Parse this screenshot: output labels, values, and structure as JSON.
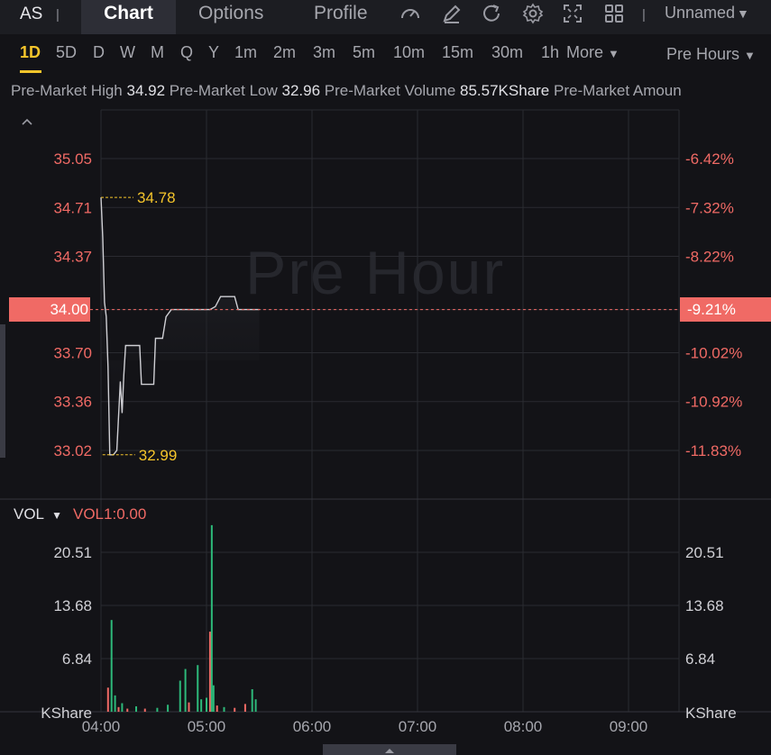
{
  "topnav": {
    "ticker": "AS",
    "sep": "|",
    "tabs": [
      {
        "label": "Chart",
        "active": true
      },
      {
        "label": "Options",
        "active": false
      },
      {
        "label": "Profile",
        "active": false
      }
    ],
    "icons": [
      "gauge-icon",
      "edit-icon",
      "refresh-icon",
      "gear-icon",
      "fullscreen-icon",
      "grid-icon"
    ],
    "account": "Unnamed"
  },
  "timeframes": [
    "1D",
    "5D",
    "D",
    "W",
    "M",
    "Q",
    "Y",
    "1m",
    "2m",
    "3m",
    "5m",
    "10m",
    "15m",
    "30m",
    "1h"
  ],
  "active_timeframe": "1D",
  "more_label": "More",
  "session_label": "Pre Hours",
  "stats": [
    {
      "label": "Pre-Market High",
      "value": "34.92"
    },
    {
      "label": "Pre-Market Low",
      "value": "32.96"
    },
    {
      "label": "Pre-Market Volume",
      "value": "85.57KShare"
    },
    {
      "label": "Pre-Market Amoun",
      "value": ""
    }
  ],
  "watermark": "Pre Hour",
  "price_tag": "34.00",
  "pct_tag": "-9.21%",
  "vol_panel": {
    "label": "VOL",
    "indicator": "VOL1:0.00",
    "unit": "KShare"
  },
  "colors": {
    "up": "#2db97a",
    "down": "#f06a65",
    "line": "#cfcfd4",
    "highlight": "#f5c52b",
    "grid": "#2a2b31"
  },
  "chart_data": {
    "type": "line",
    "price_axis": {
      "ticks": [
        35.05,
        34.71,
        34.37,
        34.0,
        33.7,
        33.36,
        33.02
      ],
      "tick_labels": [
        "35.05",
        "34.71",
        "34.37",
        "34.00",
        "33.70",
        "33.36",
        "33.02"
      ],
      "pct_labels": [
        "-6.42%",
        "-7.32%",
        "-8.22%",
        "-9.21%",
        "-10.02%",
        "-10.92%",
        "-11.83%"
      ]
    },
    "time_axis": {
      "ticks": [
        "04:00",
        "05:00",
        "06:00",
        "07:00",
        "08:00",
        "09:00"
      ]
    },
    "annotations": {
      "high": {
        "time": "04:00",
        "value": 34.78,
        "label": "34.78"
      },
      "low": {
        "time": "04:05",
        "value": 32.99,
        "label": "32.99"
      }
    },
    "price_series": {
      "name": "",
      "points": [
        [
          "04:00",
          34.78
        ],
        [
          "04:01",
          34.5
        ],
        [
          "04:02",
          34.05
        ],
        [
          "04:03",
          33.95
        ],
        [
          "04:04",
          33.6
        ],
        [
          "04:05",
          32.99
        ],
        [
          "04:07",
          32.99
        ],
        [
          "04:09",
          33.02
        ],
        [
          "04:11",
          33.5
        ],
        [
          "04:12",
          33.28
        ],
        [
          "04:13",
          33.55
        ],
        [
          "04:14",
          33.75
        ],
        [
          "04:22",
          33.75
        ],
        [
          "04:23",
          33.48
        ],
        [
          "04:30",
          33.48
        ],
        [
          "04:31",
          33.8
        ],
        [
          "04:35",
          33.8
        ],
        [
          "04:37",
          33.95
        ],
        [
          "04:40",
          34.0
        ],
        [
          "05:02",
          34.0
        ],
        [
          "05:05",
          34.02
        ],
        [
          "05:08",
          34.09
        ],
        [
          "05:16",
          34.09
        ],
        [
          "05:18",
          34.0
        ],
        [
          "05:30",
          34.0
        ]
      ]
    },
    "volume_axis": {
      "ticks": [
        20.51,
        13.68,
        6.84
      ],
      "tick_labels": [
        "20.51",
        "13.68",
        "6.84"
      ]
    },
    "volume_series": {
      "name": "",
      "bars": [
        {
          "time": "04:04",
          "value": 3.1,
          "dir": "down"
        },
        {
          "time": "04:06",
          "value": 11.8,
          "dir": "up"
        },
        {
          "time": "04:08",
          "value": 2.1,
          "dir": "up"
        },
        {
          "time": "04:10",
          "value": 0.6,
          "dir": "down"
        },
        {
          "time": "04:12",
          "value": 1.1,
          "dir": "up"
        },
        {
          "time": "04:15",
          "value": 0.4,
          "dir": "down"
        },
        {
          "time": "04:20",
          "value": 0.7,
          "dir": "up"
        },
        {
          "time": "04:25",
          "value": 0.4,
          "dir": "down"
        },
        {
          "time": "04:32",
          "value": 0.5,
          "dir": "up"
        },
        {
          "time": "04:38",
          "value": 0.9,
          "dir": "up"
        },
        {
          "time": "04:45",
          "value": 4.0,
          "dir": "up"
        },
        {
          "time": "04:48",
          "value": 5.5,
          "dir": "up"
        },
        {
          "time": "04:50",
          "value": 1.2,
          "dir": "down"
        },
        {
          "time": "04:55",
          "value": 6.0,
          "dir": "up"
        },
        {
          "time": "04:57",
          "value": 1.6,
          "dir": "up"
        },
        {
          "time": "05:00",
          "value": 1.8,
          "dir": "up"
        },
        {
          "time": "05:02",
          "value": 10.3,
          "dir": "down"
        },
        {
          "time": "05:03",
          "value": 24.0,
          "dir": "up"
        },
        {
          "time": "05:04",
          "value": 3.4,
          "dir": "up"
        },
        {
          "time": "05:06",
          "value": 0.8,
          "dir": "down"
        },
        {
          "time": "05:10",
          "value": 0.6,
          "dir": "up"
        },
        {
          "time": "05:16",
          "value": 0.5,
          "dir": "down"
        },
        {
          "time": "05:22",
          "value": 1.0,
          "dir": "down"
        },
        {
          "time": "05:26",
          "value": 2.9,
          "dir": "up"
        },
        {
          "time": "05:28",
          "value": 1.6,
          "dir": "up"
        }
      ]
    }
  }
}
